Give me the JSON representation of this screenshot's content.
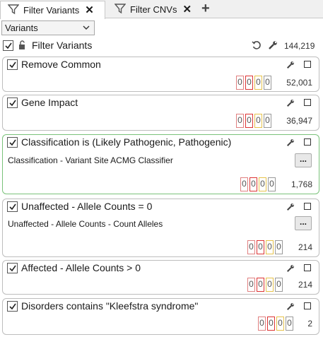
{
  "tabs": [
    {
      "label": "Filter Variants",
      "active": true
    },
    {
      "label": "Filter CNVs",
      "active": false
    }
  ],
  "dropdown": {
    "value": "Variants"
  },
  "root": {
    "label": "Filter Variants",
    "count": "144,219",
    "checked": true
  },
  "filters": [
    {
      "title": "Remove Common",
      "counts": [
        "0",
        "0",
        "0",
        "0"
      ],
      "total": "52,001",
      "sub": null
    },
    {
      "title": "Gene Impact",
      "counts": [
        "0",
        "0",
        "0",
        "0"
      ],
      "total": "36,947",
      "sub": null
    },
    {
      "title": "Classification is (Likely Pathogenic, Pathogenic)",
      "counts": [
        "0",
        "0",
        "0",
        "0"
      ],
      "total": "1,768",
      "sub": "Classification - Variant Site ACMG Classifier",
      "more": "...",
      "highlight": true
    },
    {
      "title": "Unaffected - Allele Counts = 0",
      "counts": [
        "0",
        "0",
        "0",
        "0"
      ],
      "total": "214",
      "sub": "Unaffected - Allele Counts - Count Alleles",
      "more": "..."
    },
    {
      "title": "Affected - Allele Counts > 0",
      "counts": [
        "0",
        "0",
        "0",
        "0"
      ],
      "total": "214",
      "sub": null
    },
    {
      "title": "Disorders contains \"Kleefstra syndrome\"",
      "counts": [
        "0",
        "0",
        "0",
        "0"
      ],
      "total": "2",
      "sub": null
    }
  ],
  "colors": {
    "highlight_border": "#7ac27a",
    "count_border_1": "#e08080",
    "count_border_2": "#dd3333",
    "count_border_3": "#e6c24b",
    "count_border_4": "#999999"
  }
}
